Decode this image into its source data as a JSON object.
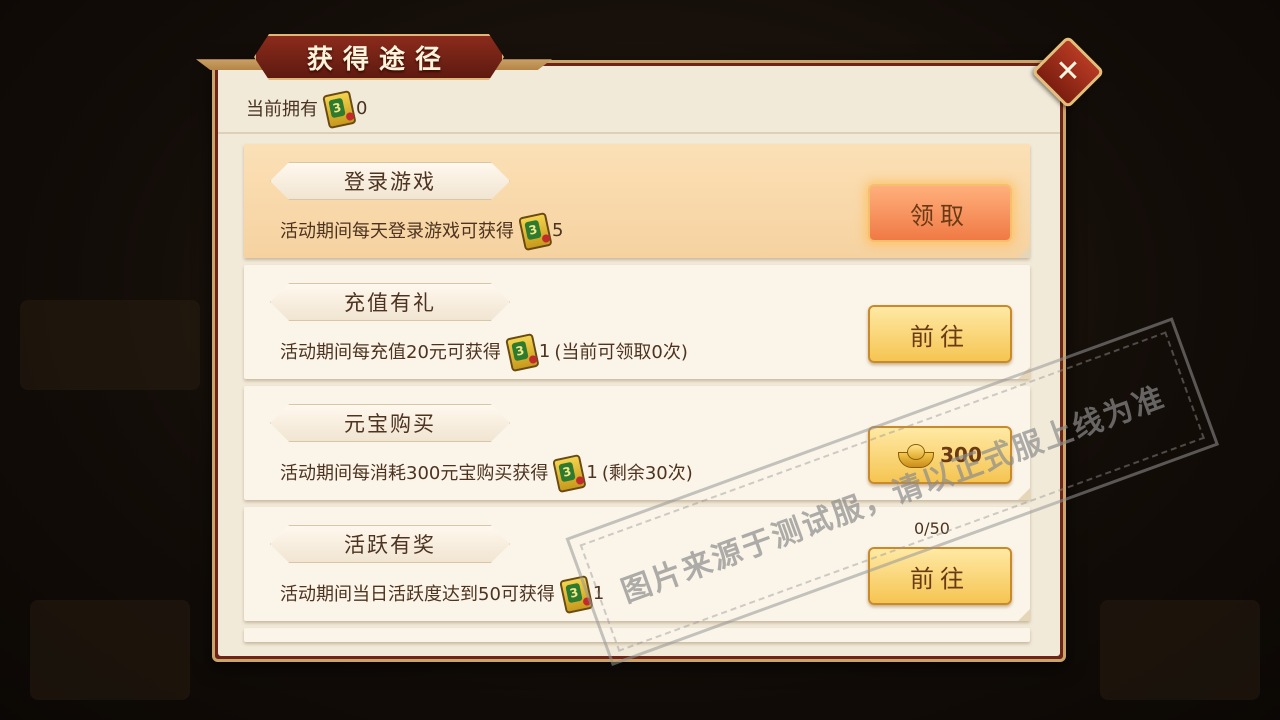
{
  "dialog": {
    "title": "获得途径",
    "owned_label": "当前拥有",
    "owned_count": "0",
    "close_icon": "close-icon"
  },
  "cards": [
    {
      "title": "登录游戏",
      "description": "活动期间每天登录游戏可获得",
      "reward_amount": "5",
      "reward_note": "",
      "button_label": "领取",
      "button_type": "claim"
    },
    {
      "title": "充值有礼",
      "description": "活动期间每充值20元可获得",
      "reward_amount": "1",
      "reward_note": "(当前可领取0次)",
      "button_label": "前往",
      "button_type": "goto"
    },
    {
      "title": "元宝购买",
      "description": "活动期间每消耗300元宝购买获得",
      "reward_amount": "1",
      "reward_note": "(剩余30次)",
      "button_label": "300",
      "button_type": "purchase",
      "button_icon": "gold-ingot-icon"
    },
    {
      "title": "活跃有奖",
      "description": "活动期间当日活跃度达到50可获得",
      "reward_amount": "1",
      "reward_note": "",
      "progress": "0/50",
      "button_label": "前往",
      "button_type": "goto"
    }
  ],
  "watermark": "图片来源于测试服，请以正式服上线为准",
  "reward_icon": "ticket-token-icon",
  "colors": {
    "panel_frame": "#6e2418",
    "panel_bg": "#f2ead9",
    "claim_button": "#f07a45",
    "goto_button": "#f5c552",
    "text": "#4d3320"
  }
}
